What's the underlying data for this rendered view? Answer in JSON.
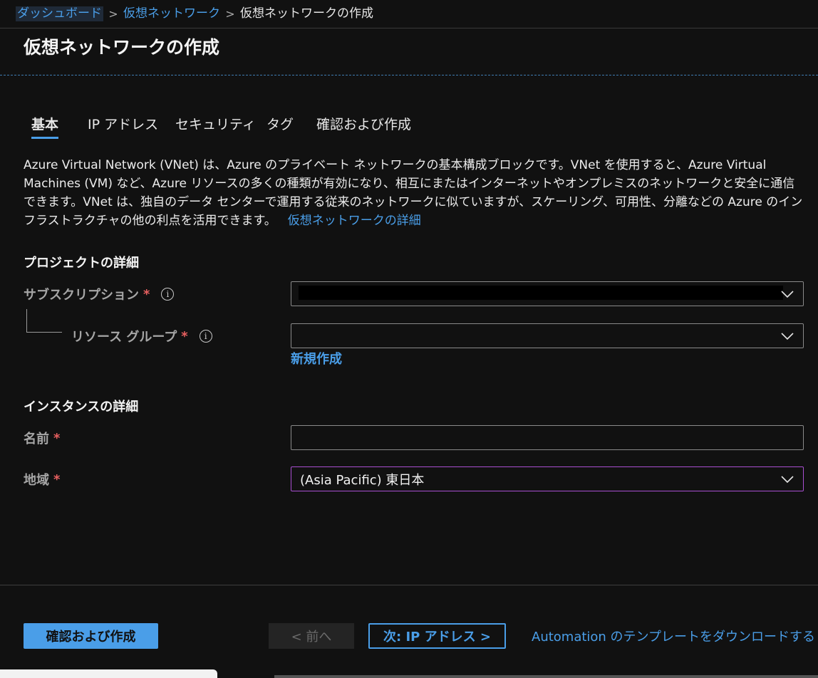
{
  "breadcrumb": {
    "items": [
      "ダッシュボード",
      "仮想ネットワーク"
    ],
    "current": "仮想ネットワークの作成",
    "separator": ">"
  },
  "page": {
    "title": "仮想ネットワークの作成"
  },
  "tabs": [
    {
      "label": "基本",
      "active": true
    },
    {
      "label": "IP アドレス",
      "active": false
    },
    {
      "label": "セキュリティ",
      "active": false
    },
    {
      "label": "タグ",
      "active": false
    },
    {
      "label": "確認および作成",
      "active": false
    }
  ],
  "description": {
    "text": "Azure Virtual Network (VNet) は、Azure のプライベート ネットワークの基本構成ブロックです。VNet を使用すると、Azure Virtual Machines (VM) など、Azure リソースの多くの種類が有効になり、相互にまたはインターネットやオンプレミスのネットワークと安全に通信できます。VNet は、独自のデータ センターで運用する従来のネットワークに似ていますが、スケーリング、可用性、分離などの Azure のインフラストラクチャの他の利点を活用できます。",
    "link": "仮想ネットワークの詳細"
  },
  "project_details": {
    "heading": "プロジェクトの詳細",
    "subscription_label": "サブスクリプション",
    "subscription_value": "",
    "resource_group_label": "リソース グループ",
    "resource_group_value": "",
    "new_link": "新規作成"
  },
  "instance_details": {
    "heading": "インスタンスの詳細",
    "name_label": "名前",
    "name_value": "",
    "region_label": "地域",
    "region_value": "(Asia Pacific) 東日本"
  },
  "required_marker": "*",
  "info_glyph": "i",
  "footer": {
    "review_create": "確認および作成",
    "previous": "< 前へ",
    "next": "次: IP アドレス >",
    "automation_link": "Automation のテンプレートをダウンロードする"
  },
  "colors": {
    "background": "#111111",
    "accent": "#4a9ee8",
    "focus_border": "#a94fd2",
    "required": "#e86060"
  }
}
